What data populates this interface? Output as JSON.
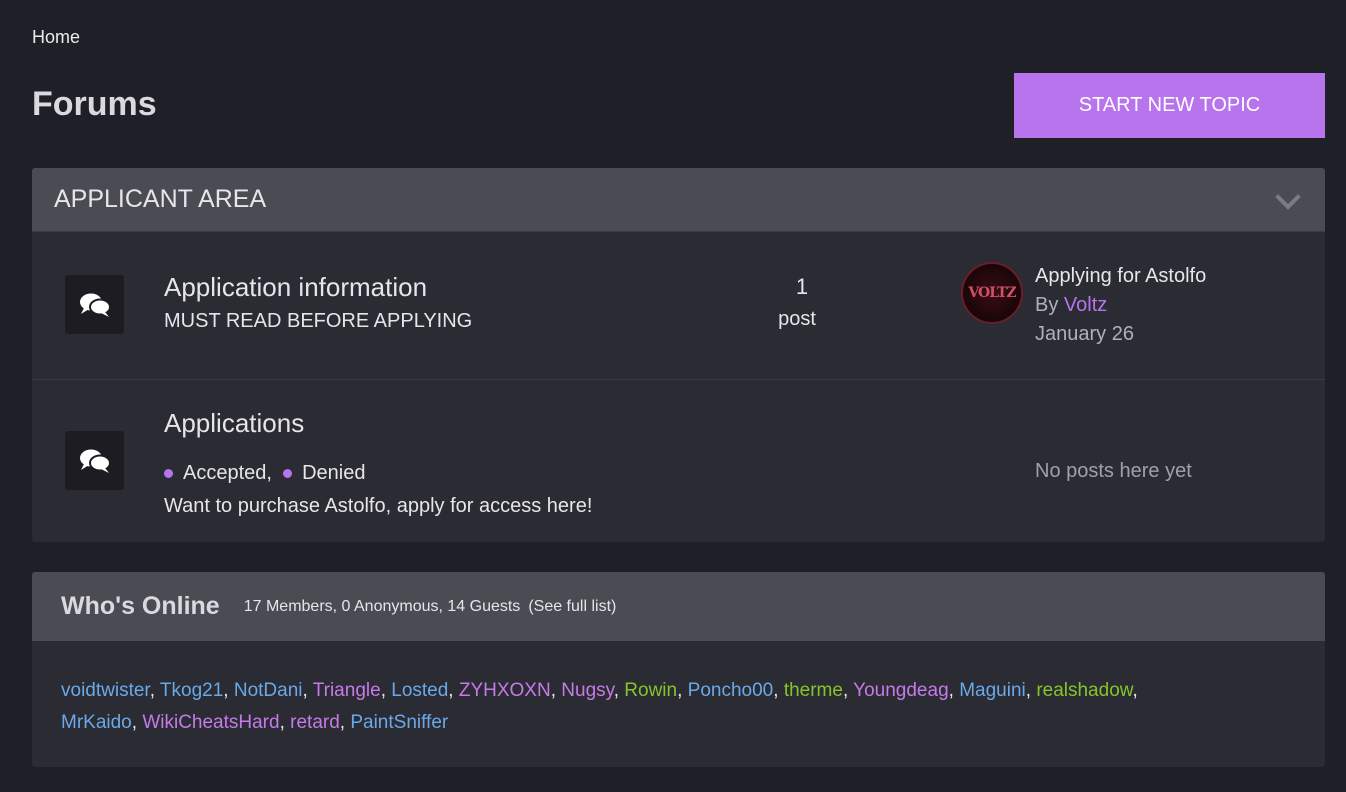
{
  "breadcrumb": {
    "home": "Home"
  },
  "page": {
    "title": "Forums",
    "new_topic": "START NEW TOPIC"
  },
  "category": {
    "title": "APPLICANT AREA",
    "forums": [
      {
        "title": "Application information",
        "description": "MUST READ BEFORE APPLYING",
        "post_count": "1",
        "post_label": "post",
        "last_post": {
          "avatar_text": "VOLTZ",
          "title": "Applying for Astolfo",
          "by_prefix": "By ",
          "author": "Voltz",
          "date": "January 26"
        }
      },
      {
        "title": "Applications",
        "subforums": [
          "Accepted",
          "Denied"
        ],
        "description": "Want to purchase Astolfo, apply for access here!",
        "no_posts": "No posts here yet"
      }
    ]
  },
  "online": {
    "title": "Who's Online",
    "counts": "17 Members, 0 Anonymous, 14 Guests",
    "full_list": "(See full list)",
    "members": [
      {
        "name": "voidtwister",
        "color": "#6aa9e8"
      },
      {
        "name": "Tkog21",
        "color": "#6aa9e8"
      },
      {
        "name": "NotDani",
        "color": "#6aa9e8"
      },
      {
        "name": "Triangle",
        "color": "#c77ae8"
      },
      {
        "name": "Losted",
        "color": "#6aa9e8"
      },
      {
        "name": "ZYHXOXN",
        "color": "#c77ae8"
      },
      {
        "name": "Nugsy",
        "color": "#c77ae8"
      },
      {
        "name": "Rowin",
        "color": "#86c52a"
      },
      {
        "name": "Poncho00",
        "color": "#6aa9e8"
      },
      {
        "name": "therme",
        "color": "#86c52a"
      },
      {
        "name": "Youngdeag",
        "color": "#c77ae8"
      },
      {
        "name": "Maguini",
        "color": "#6aa9e8"
      },
      {
        "name": "realshadow",
        "color": "#86c52a"
      },
      {
        "name": "MrKaido",
        "color": "#6aa9e8"
      },
      {
        "name": "WikiCheatsHard",
        "color": "#c77ae8"
      },
      {
        "name": "retard",
        "color": "#c77ae8"
      },
      {
        "name": "PaintSniffer",
        "color": "#6aa9e8"
      }
    ]
  }
}
